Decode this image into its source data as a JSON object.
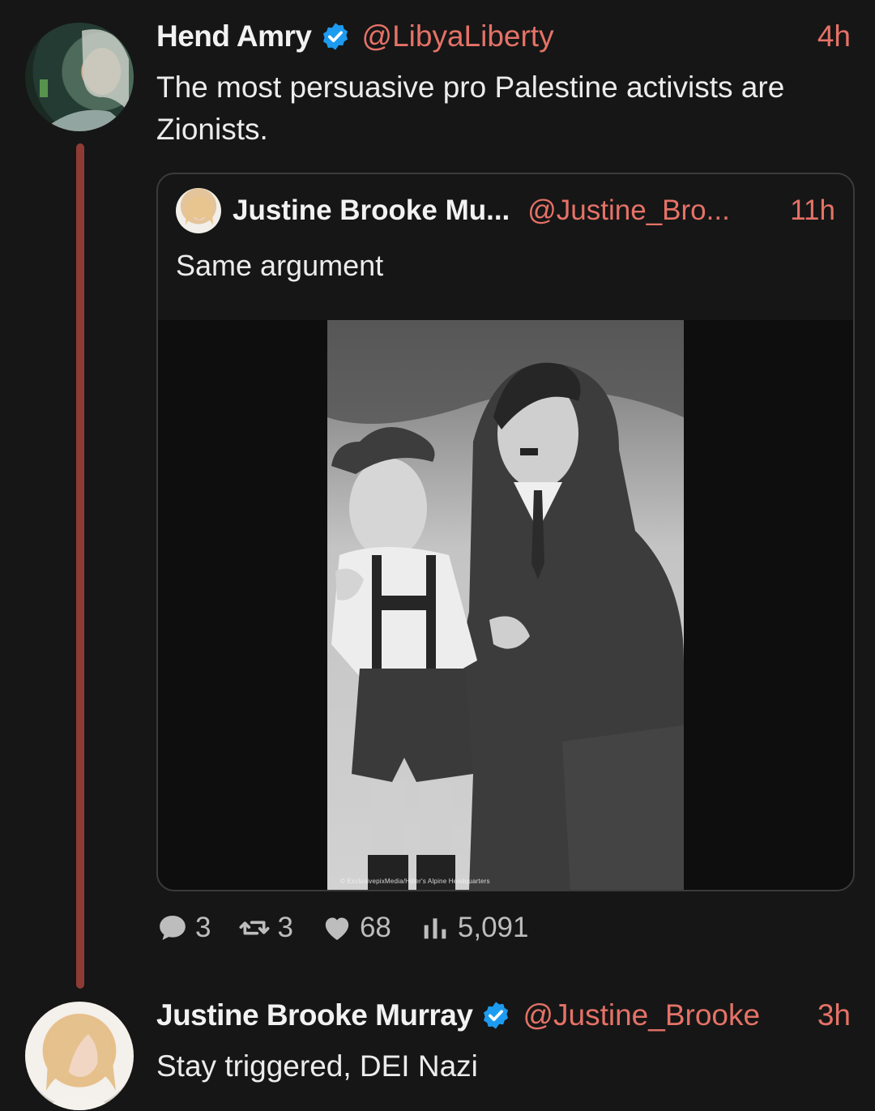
{
  "tweets": [
    {
      "name": "Hend Amry",
      "handle": "@LibyaLiberty",
      "time": "4h",
      "text": "The most persuasive pro Palestine activists are Zionists.",
      "quote": {
        "name": "Justine Brooke Mu...",
        "handle": "@Justine_Bro...",
        "time": "11h",
        "text": "Same argument",
        "image_caption": "© ExclusivepixMedia/Hitler's Alpine Headquarters"
      },
      "stats": {
        "replies": "3",
        "retweets": "3",
        "likes": "68",
        "views": "5,091"
      }
    },
    {
      "name": "Justine Brooke Murray",
      "handle": "@Justine_Brooke",
      "time": "3h",
      "text": "Stay triggered, DEI Nazi"
    }
  ],
  "colors": {
    "background": "#161616",
    "accent": "#e57267",
    "thread_line": "#8e3b35",
    "verified": "#1d9bf0"
  },
  "icons": [
    "verified-badge-icon",
    "reply-icon",
    "retweet-icon",
    "like-icon",
    "views-icon"
  ]
}
